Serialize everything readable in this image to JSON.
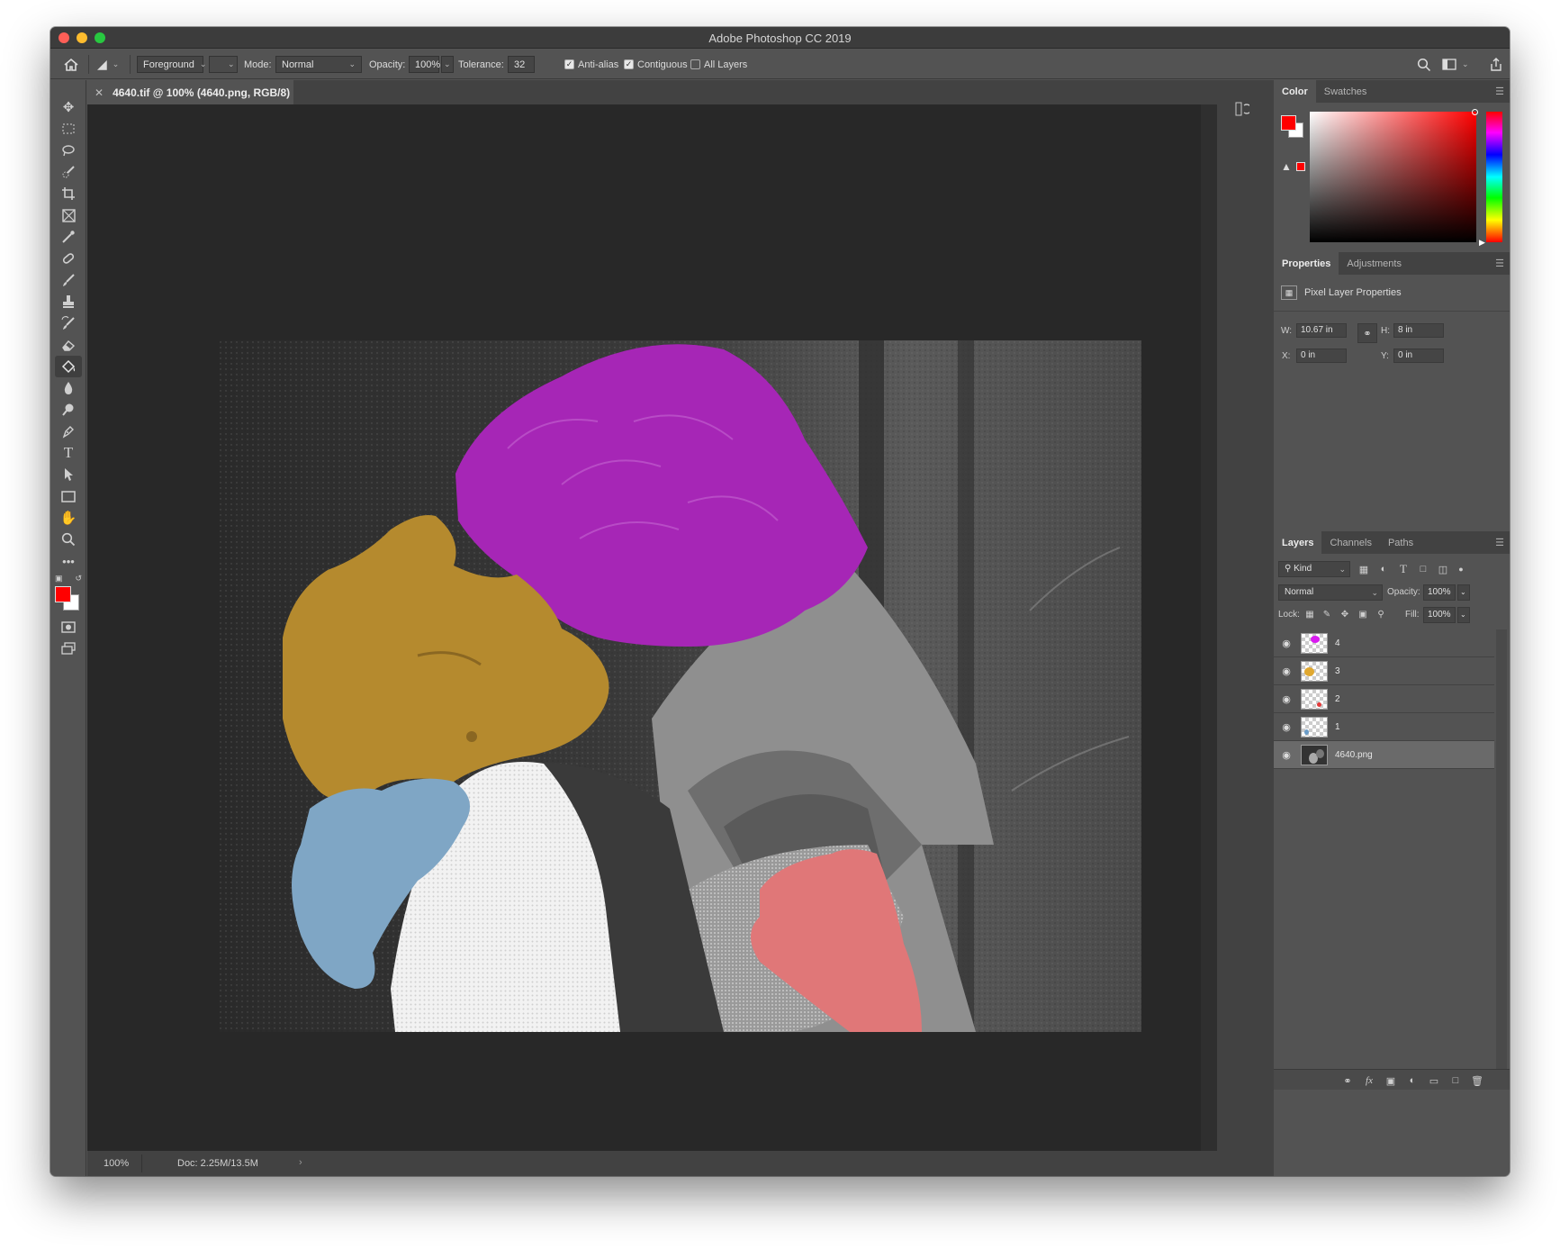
{
  "window": {
    "title": "Adobe Photoshop CC 2019"
  },
  "options_bar": {
    "fill_source": "Foreground",
    "mode_label": "Mode:",
    "mode_value": "Normal",
    "opacity_label": "Opacity:",
    "opacity_value": "100%",
    "tolerance_label": "Tolerance:",
    "tolerance_value": "32",
    "anti_alias": {
      "label": "Anti-alias",
      "checked": true
    },
    "contiguous": {
      "label": "Contiguous",
      "checked": true
    },
    "all_layers": {
      "label": "All Layers",
      "checked": false
    }
  },
  "document": {
    "tab_title": "4640.tif @ 100% (4640.png, RGB/8)",
    "zoom": "100%",
    "doc_size": "Doc: 2.25M/13.5M"
  },
  "toolbar": {
    "tools": [
      "move-icon",
      "marquee-icon",
      "lasso-icon",
      "quick-select-icon",
      "crop-icon",
      "frame-icon",
      "eyedropper-icon",
      "healing-icon",
      "brush-icon",
      "stamp-icon",
      "history-brush-icon",
      "eraser-icon",
      "paint-bucket-icon",
      "blur-icon",
      "dodge-icon",
      "pen-icon",
      "type-icon",
      "path-select-icon",
      "rectangle-icon",
      "hand-icon",
      "zoom-icon",
      "more-icon"
    ],
    "active_tool": "paint-bucket-icon",
    "foreground_color": "#ff0000",
    "background_color": "#ffffff"
  },
  "color_panel": {
    "tabs": [
      "Color",
      "Swatches"
    ],
    "active_tab": "Color",
    "hue": "#ff0000"
  },
  "properties_panel": {
    "tabs": [
      "Properties",
      "Adjustments"
    ],
    "active_tab": "Properties",
    "heading": "Pixel Layer Properties",
    "w_label": "W:",
    "w_value": "10.67 in",
    "h_label": "H:",
    "h_value": "8 in",
    "x_label": "X:",
    "x_value": "0 in",
    "y_label": "Y:",
    "y_value": "0 in"
  },
  "layers_panel": {
    "tabs": [
      "Layers",
      "Channels",
      "Paths"
    ],
    "active_tab": "Layers",
    "filter_kind": "Kind",
    "blend_mode": "Normal",
    "opacity_label": "Opacity:",
    "opacity_value": "100%",
    "lock_label": "Lock:",
    "fill_label": "Fill:",
    "fill_value": "100%",
    "layers": [
      {
        "name": "4",
        "swatch": "#d91cf0",
        "selected": false
      },
      {
        "name": "3",
        "swatch": "#e0a830",
        "selected": false
      },
      {
        "name": "2",
        "swatch": "#e43a3a",
        "selected": false
      },
      {
        "name": "1",
        "swatch": "#6a9cc8",
        "selected": false
      },
      {
        "name": "4640.png",
        "swatch": "",
        "selected": true
      }
    ]
  },
  "overlay_colors": {
    "hair": "#a626b6",
    "face": "#b58a2e",
    "left_hand": "#7fa6c5",
    "right_hand": "#e07778"
  }
}
